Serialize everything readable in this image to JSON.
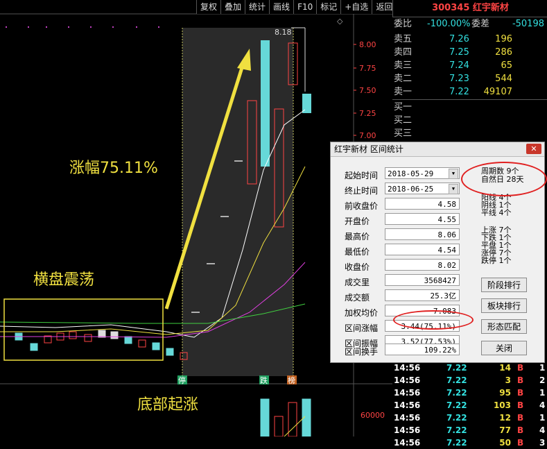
{
  "toolbar": [
    "复权",
    "叠加",
    "统计",
    "画线",
    "F10",
    "标记",
    "+自选",
    "返回"
  ],
  "symbol": "300345 红宇新材",
  "ratio": {
    "label1": "委比",
    "value1": "-100.00%",
    "label2": "委差",
    "value2": "-50198"
  },
  "asks": [
    {
      "label": "卖五",
      "price": "7.26",
      "vol": "196"
    },
    {
      "label": "卖四",
      "price": "7.25",
      "vol": "286"
    },
    {
      "label": "卖三",
      "price": "7.24",
      "vol": "65"
    },
    {
      "label": "卖二",
      "price": "7.23",
      "vol": "544"
    },
    {
      "label": "卖一",
      "price": "7.22",
      "vol": "49107"
    }
  ],
  "bids": [
    {
      "label": "买一"
    },
    {
      "label": "买二"
    },
    {
      "label": "买三"
    }
  ],
  "ticks": [
    {
      "time": "14:56",
      "price": "7.22",
      "vol": "14",
      "bs": "B",
      "n": "1"
    },
    {
      "time": "14:56",
      "price": "7.22",
      "vol": "3",
      "bs": "B",
      "n": "2"
    },
    {
      "time": "14:56",
      "price": "7.22",
      "vol": "95",
      "bs": "B",
      "n": "1"
    },
    {
      "time": "14:56",
      "price": "7.22",
      "vol": "103",
      "bs": "B",
      "n": "4"
    },
    {
      "time": "14:56",
      "price": "7.22",
      "vol": "12",
      "bs": "B",
      "n": "1"
    },
    {
      "time": "14:56",
      "price": "7.22",
      "vol": "77",
      "bs": "B",
      "n": "4"
    },
    {
      "time": "14:56",
      "price": "7.22",
      "vol": "50",
      "bs": "B",
      "n": "3"
    }
  ],
  "price_axis": [
    "8.00",
    "7.75",
    "7.50",
    "7.25",
    "7.00"
  ],
  "vol_axis": "60000",
  "high_label": "8.18",
  "markers": [
    "停",
    "跌",
    "榜"
  ],
  "annotations": {
    "gain": "涨幅75.11%",
    "consolidation": "横盘震荡",
    "bottom": "底部起涨"
  },
  "dialog": {
    "title": "红宇新材 区间统计",
    "close": "✕",
    "fields": [
      {
        "label": "起始时间",
        "value": "2018-05-29",
        "dropdown": true
      },
      {
        "label": "终止时间",
        "value": "2018-06-25",
        "dropdown": true
      },
      {
        "label": "前收盘价",
        "value": "4.58"
      },
      {
        "label": "开盘价",
        "value": "4.55"
      },
      {
        "label": "最高价",
        "value": "8.06"
      },
      {
        "label": "最低价",
        "value": "4.54"
      },
      {
        "label": "收盘价",
        "value": "8.02"
      },
      {
        "label": "成交里",
        "value": "3568427"
      },
      {
        "label": "成交额",
        "value": "25.3亿"
      },
      {
        "label": "加权均价",
        "value": "7.083"
      },
      {
        "label": "区间涨幅",
        "value": "3.44(75.11%)"
      },
      {
        "label": "区间振幅",
        "value": "3.52(77.53%)"
      },
      {
        "label": "区间换手",
        "value": "109.22%"
      }
    ],
    "counts1": [
      "周期数 9个",
      "自然日 28天"
    ],
    "counts2": [
      "阳线 4个",
      "阴线 1个",
      "平线 4个"
    ],
    "counts3": [
      "上涨 7个",
      "下跌 1个",
      "平盘 1个",
      "涨停 7个",
      "跌停 1个"
    ],
    "buttons": [
      "阶段排行",
      "板块排行",
      "形态匹配",
      "关闭"
    ]
  }
}
